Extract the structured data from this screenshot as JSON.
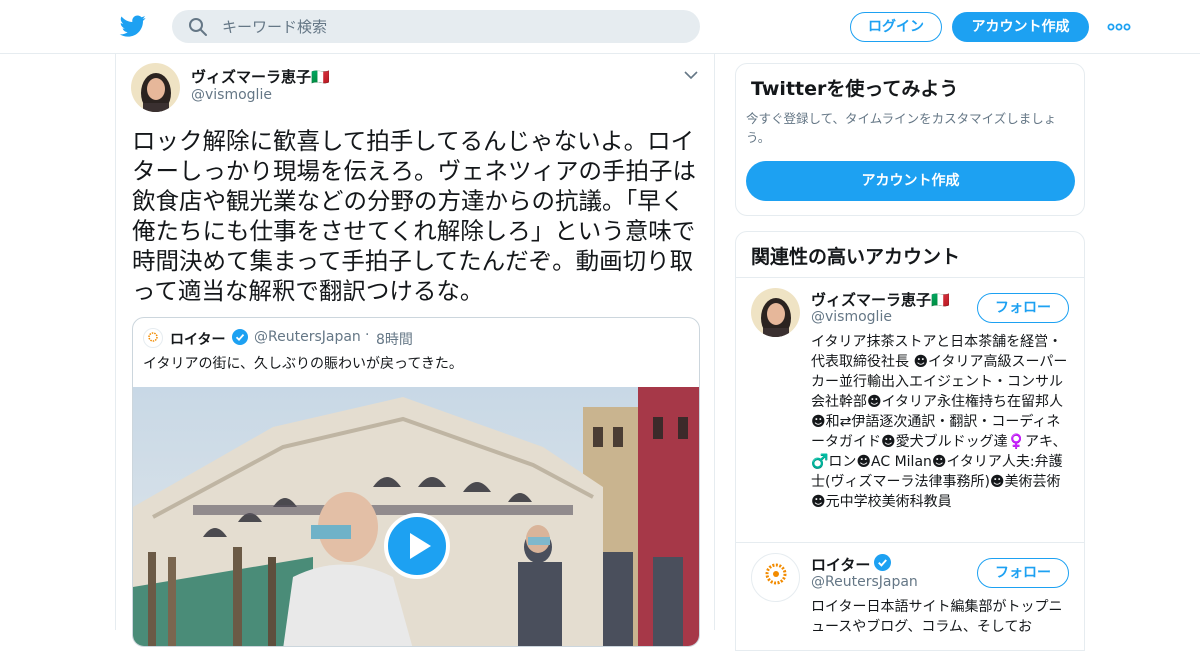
{
  "header": {
    "search_placeholder": "キーワード検索",
    "login_label": "ログイン",
    "signup_label": "アカウント作成",
    "brand_color": "#1da1f2"
  },
  "tweet": {
    "author_name": "ヴィズマーラ恵子🇮🇹",
    "author_handle": "@vismoglie",
    "text": "ロック解除に歓喜して拍手してるんじゃないよ。ロイターしっかり現場を伝えろ。ヴェネツィアの手拍子は飲食店や観光業などの分野の方達からの抗議。「早く俺たちにも仕事をさせてくれ解除しろ」という意味で時間決めて集まって手拍子してたんだぞ。動画切り取って適当な解釈で翻訳つけるな。",
    "quoted": {
      "author_name": "ロイター",
      "author_handle": "@ReutersJapan",
      "separator": "·",
      "time": "8時間",
      "text": "イタリアの街に、久しぶりの賑わいが戻ってきた。"
    }
  },
  "signup_card": {
    "title": "Twitterを使ってみよう",
    "description": "今すぐ登録して、タイムラインをカスタマイズしましょう。",
    "button_label": "アカウント作成"
  },
  "related": {
    "title": "関連性の高いアカウント",
    "accounts": [
      {
        "name": "ヴィズマーラ恵子🇮🇹",
        "handle": "@vismoglie",
        "follow_label": "フォロー",
        "bio": "イタリア抹茶ストアと日本茶舗を経営・代表取締役社長 ☻イタリア高級スーパーカー並行輸出入エイジェント・コンサル会社幹部☻イタリア永住権持ち在留邦人☻和⇄伊語逐次通訳・翻訳・コーディネータガイド☻愛犬ブルドッグ達♀️アキ、♂️ロン☻AC Milan☻イタリア人夫:弁護士(ヴィズマーラ法律事務所)☻美術芸術☻元中学校美術科教員"
      },
      {
        "name": "ロイター",
        "handle": "@ReutersJapan",
        "follow_label": "フォロー",
        "bio": "ロイター日本語サイト編集部がトップニュースやブログ、コラム、そしてお"
      }
    ]
  }
}
